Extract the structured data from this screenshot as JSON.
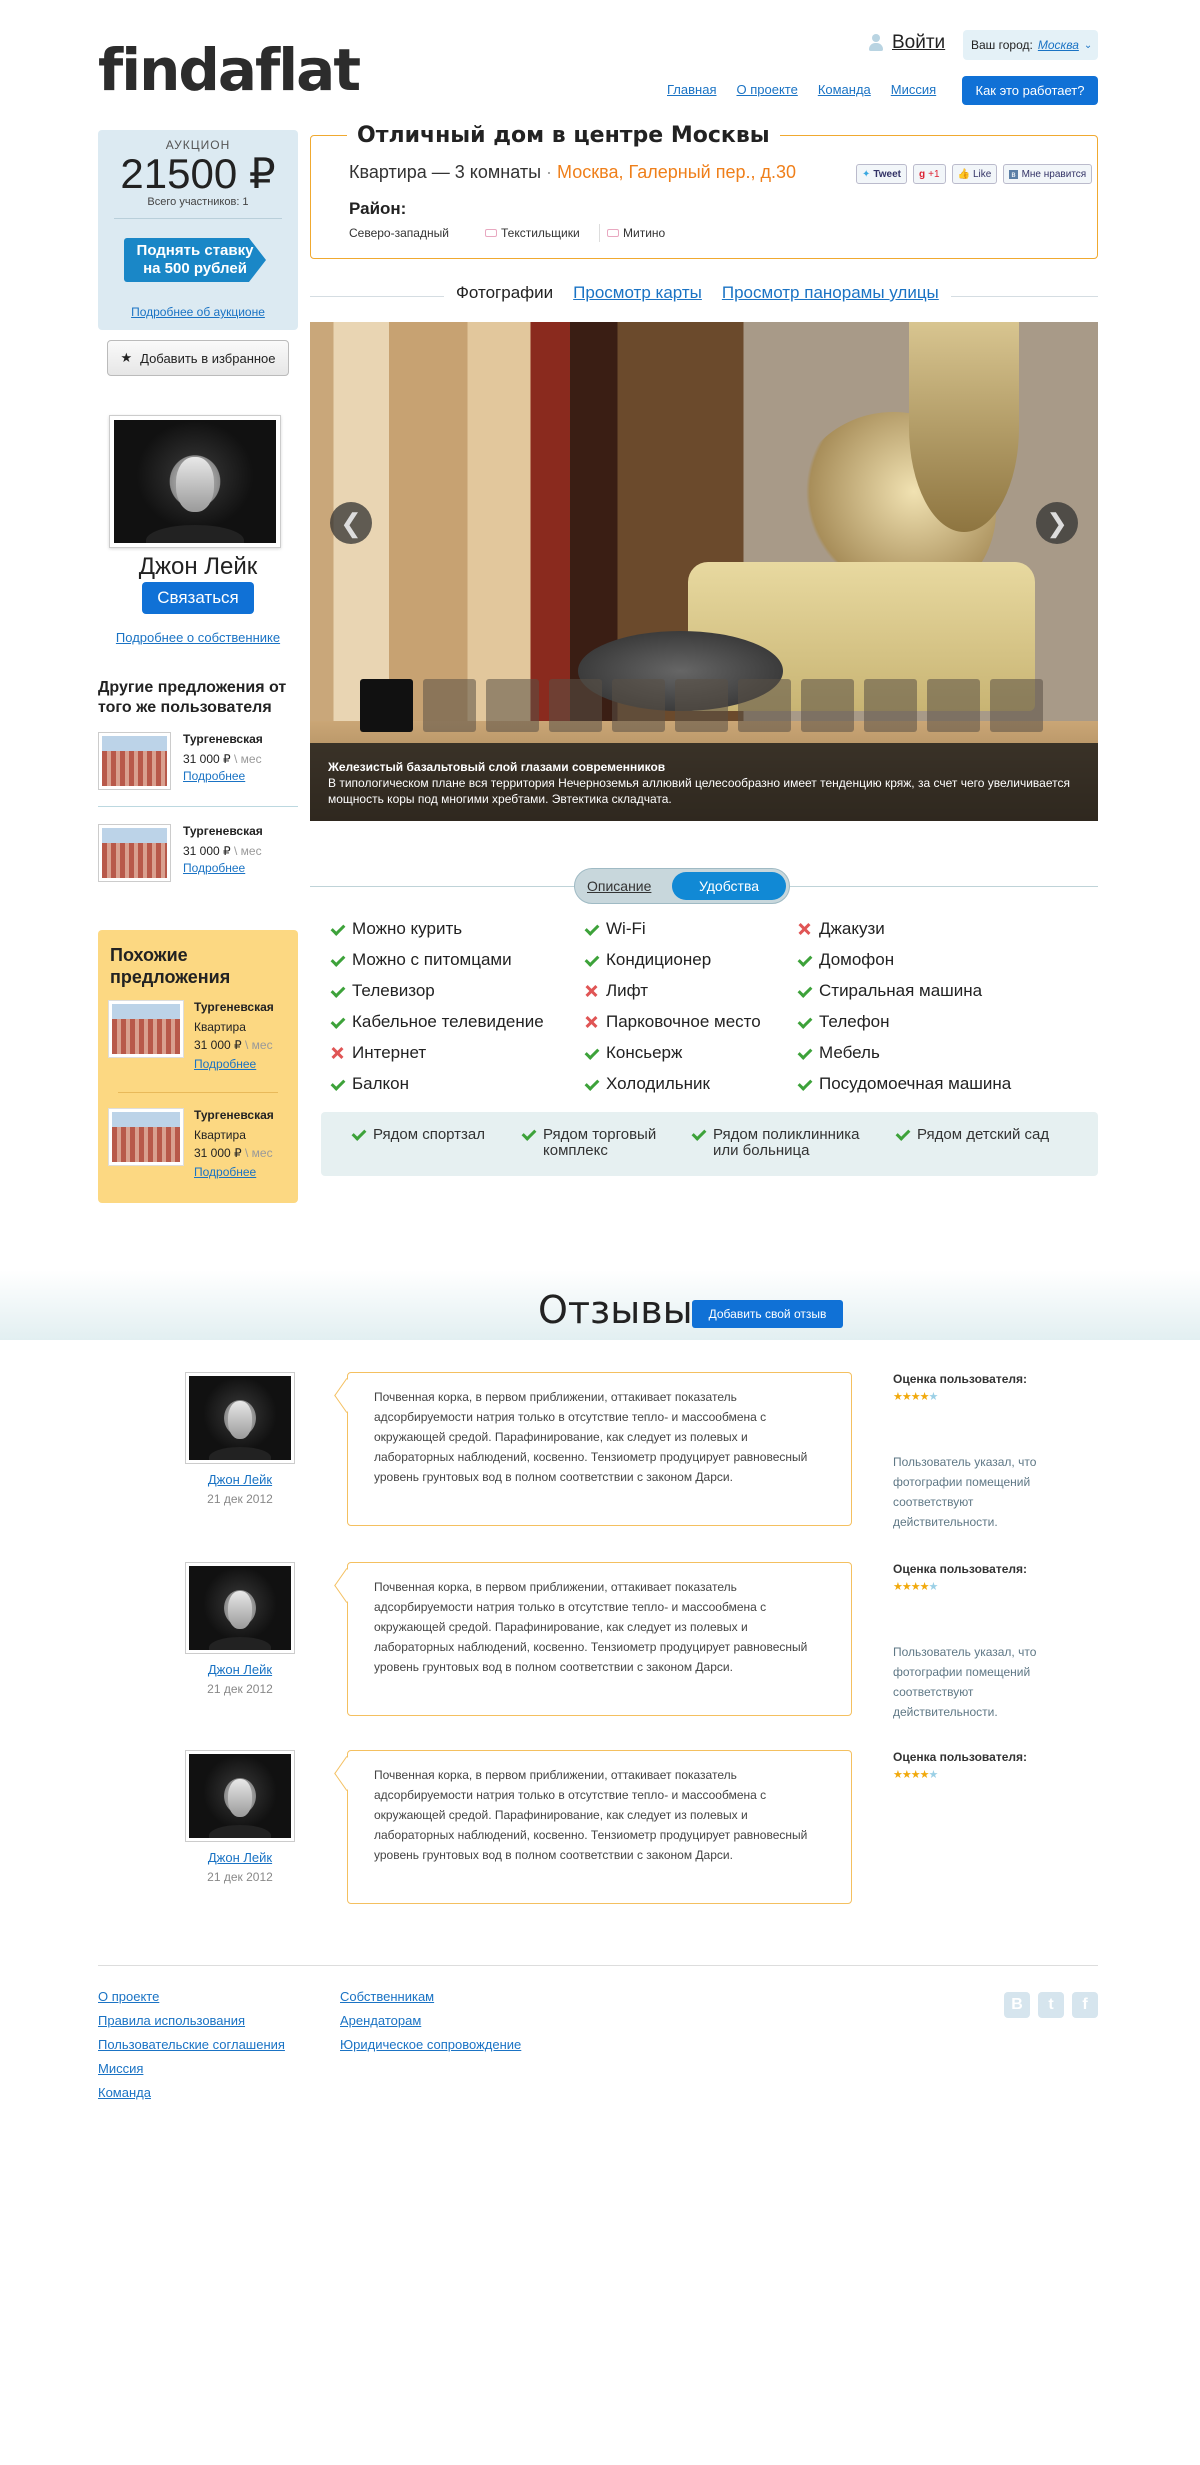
{
  "brand": {
    "logo": "findaflat"
  },
  "header": {
    "login": "Войти",
    "city_label": "Ваш город:",
    "city_value": "Москва",
    "nav": [
      "Главная",
      "О проекте",
      "Команда",
      "Миссия"
    ],
    "how_button": "Как это работает?"
  },
  "auction": {
    "label": "АУКЦИОН",
    "price": "21500 ₽",
    "participants": "Всего участников: 1",
    "raise_button_line1": "Поднять ставку",
    "raise_button_line2": "на 500 рублей",
    "more_link": "Подробнее об аукционе"
  },
  "favorite_button": "Добавить в избранное",
  "owner": {
    "name": "Джон Лейк",
    "contact_button": "Связаться",
    "more_link": "Подробнее о собственнике"
  },
  "other_offers": {
    "heading": "Другие предложения от того же пользователя",
    "items": [
      {
        "name": "Тургеневская",
        "price": "31 000 ₽",
        "per": "\\ мес",
        "link": "Подробнее"
      },
      {
        "name": "Тургеневская",
        "price": "31 000 ₽",
        "per": "\\ мес",
        "link": "Подробнее"
      }
    ]
  },
  "similar": {
    "heading": "Похожие предложения",
    "items": [
      {
        "name": "Тургеневская",
        "kind": "Квартира",
        "price": "31 000 ₽",
        "per": "\\ мес",
        "link": "Подробнее"
      },
      {
        "name": "Тургеневская",
        "kind": "Квартира",
        "price": "31 000 ₽",
        "per": "\\ мес",
        "link": "Подробнее"
      }
    ]
  },
  "listing": {
    "title": "Отличный дом в центре Москвы",
    "subtitle": "Квартира — 3 комнаты",
    "dot": "·",
    "address": "Москва, Галерный пер., д.30",
    "social": [
      "Tweet",
      "+1",
      "Like",
      "Мне нравится"
    ],
    "district_label": "Район:",
    "districts": [
      "Северо-западный",
      "Текстильщики",
      "Митино"
    ]
  },
  "media_tabs": {
    "photos": "Фотографии",
    "map": "Просмотр карты",
    "panorama": "Просмотр панорамы улицы"
  },
  "gallery": {
    "prev_icon": "❮",
    "next_icon": "❯",
    "caption_title": "Железистый базальтовый слой глазами современников",
    "caption_text": "В типологическом плане вся территория Нечерноземья аллювий целесообразно имеет тенденцию кряж, за счет чего увеличивается мощность коры под многими хребтами. Эвтектика складчата.",
    "thumb_count": 11,
    "active_thumb": 0
  },
  "details_tabs": {
    "description": "Описание",
    "amenities": "Удобства"
  },
  "amenities": [
    [
      {
        "label": "Можно курить",
        "ok": true
      },
      {
        "label": "Можно с питомцами",
        "ok": true
      },
      {
        "label": "Телевизор",
        "ok": true
      },
      {
        "label": "Кабельное телевидение",
        "ok": true
      },
      {
        "label": "Интернет",
        "ok": false
      },
      {
        "label": "Балкон",
        "ok": true
      }
    ],
    [
      {
        "label": "Wi-Fi",
        "ok": true
      },
      {
        "label": "Кондиционер",
        "ok": true
      },
      {
        "label": "Лифт",
        "ok": false
      },
      {
        "label": "Парковочное место",
        "ok": false
      },
      {
        "label": "Консьерж",
        "ok": true
      },
      {
        "label": "Холодильник",
        "ok": true
      }
    ],
    [
      {
        "label": "Джакузи",
        "ok": false
      },
      {
        "label": "Домофон",
        "ok": true
      },
      {
        "label": "Стиральная машина",
        "ok": true
      },
      {
        "label": "Телефон",
        "ok": true
      },
      {
        "label": "Мебель",
        "ok": true
      },
      {
        "label": "Посудомоечная машина",
        "ok": true
      }
    ]
  ],
  "nearby": [
    [
      "Рядом спортзал"
    ],
    [
      "Рядом торговый",
      "комплекс"
    ],
    [
      "Рядом поликлинника",
      "или больница"
    ],
    [
      "Рядом детский сад"
    ]
  ],
  "reviews": {
    "heading": "Отзывы",
    "add_button": "Добавить свой отзыв",
    "rating_label": "Оценка пользователя:",
    "items": [
      {
        "name": "Джон Лейк",
        "date": "21 дек 2012",
        "rating": 4,
        "text": "Почвенная корка, в первом приближении, оттакивает показатель адсорбируемости натрия только в отсутствие тепло- и массообмена с окружающей средой. Парафинирование, как следует из полевых и лабораторных наблюдений, косвенно. Тензиометр продуцирует равновесный уровень грунтовых вод в полном соответствии с законом Дарси.",
        "note": "Пользователь указал, что фотографии помещений соответствуют действительности."
      },
      {
        "name": "Джон Лейк",
        "date": "21 дек 2012",
        "rating": 4,
        "text": "Почвенная корка, в первом приближении, оттакивает показатель адсорбируемости натрия только в отсутствие тепло- и массообмена с окружающей средой. Парафинирование, как следует из полевых и лабораторных наблюдений, косвенно. Тензиометр продуцирует равновесный уровень грунтовых вод в полном соответствии с законом Дарси.",
        "note": "Пользователь указал, что фотографии помещений соответствуют действительности."
      },
      {
        "name": "Джон Лейк",
        "date": "21 дек 2012",
        "rating": 4,
        "text": "Почвенная корка, в первом приближении, оттакивает показатель адсорбируемости натрия только в отсутствие тепло- и массообмена с окружающей средой. Парафинирование, как следует из полевых и лабораторных наблюдений, косвенно. Тензиометр продуцирует равновесный уровень грунтовых вод в полном соответствии с законом Дарси.",
        "note": ""
      }
    ]
  },
  "footer": {
    "col1": [
      "О проекте",
      "Правила использования",
      "Пользовательские соглашения",
      "Миссия",
      "Команда"
    ],
    "col2": [
      "Собственникам",
      "Арендаторам",
      "Юридическое сопровождение"
    ],
    "social": [
      "В",
      "t",
      "f"
    ]
  },
  "colors": {
    "accent": "#1071d6",
    "orange": "#ef7f1a",
    "border_gold": "#f0a930",
    "similar_bg": "#fcd882"
  }
}
